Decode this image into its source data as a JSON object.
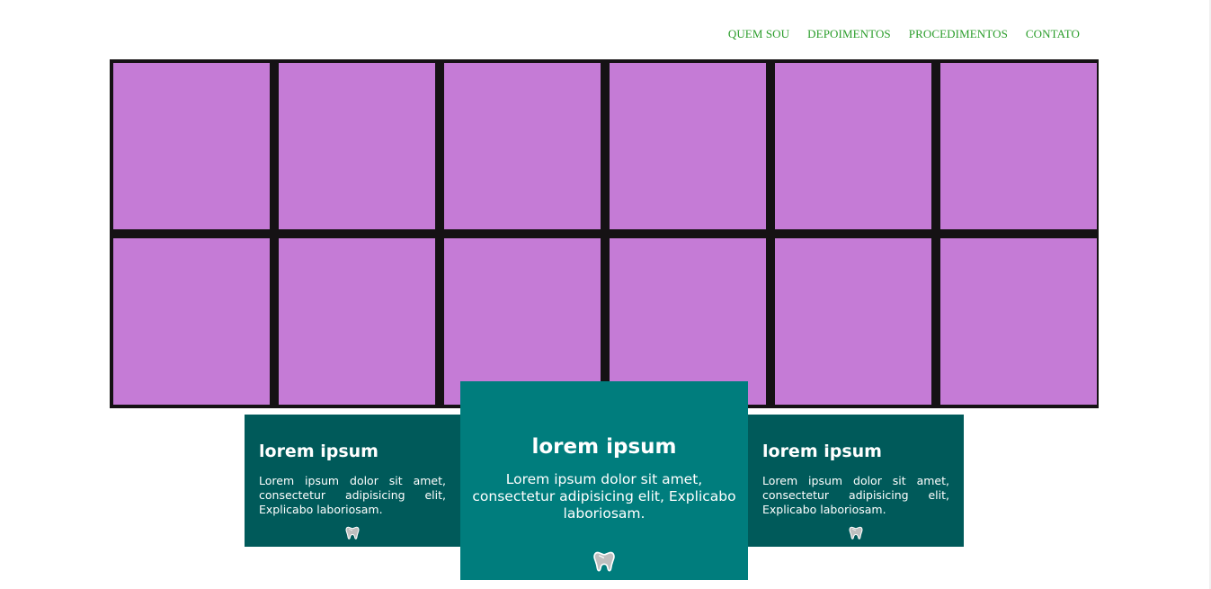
{
  "nav": {
    "items": [
      "QUEM SOU",
      "DEPOIMENTOS",
      "PROCEDIMENTOS",
      "CONTATO"
    ]
  },
  "gallery": {
    "tile_color": "#c57bd6",
    "border_color": "#151214",
    "rows": 2,
    "columns": 6
  },
  "cards": [
    {
      "title": "lorem ipsum",
      "text": "Lorem ipsum dolor sit amet, consectetur adipisicing elit, Explicabo laboriosam.",
      "icon": "tooth-icon",
      "color": "#005a5a"
    },
    {
      "title": "lorem ipsum",
      "text": "Lorem ipsum dolor sit amet, consectetur adipisicing elit, Explicabo laboriosam.",
      "icon": "tooth-icon",
      "color": "#007d7d"
    },
    {
      "title": "lorem ipsum",
      "text": "Lorem ipsum dolor sit amet, consectetur adipisicing elit, Explicabo laboriosam.",
      "icon": "tooth-icon",
      "color": "#005a5a"
    }
  ],
  "colors": {
    "nav_link": "#2a9d2a",
    "background": "#ffffff"
  }
}
